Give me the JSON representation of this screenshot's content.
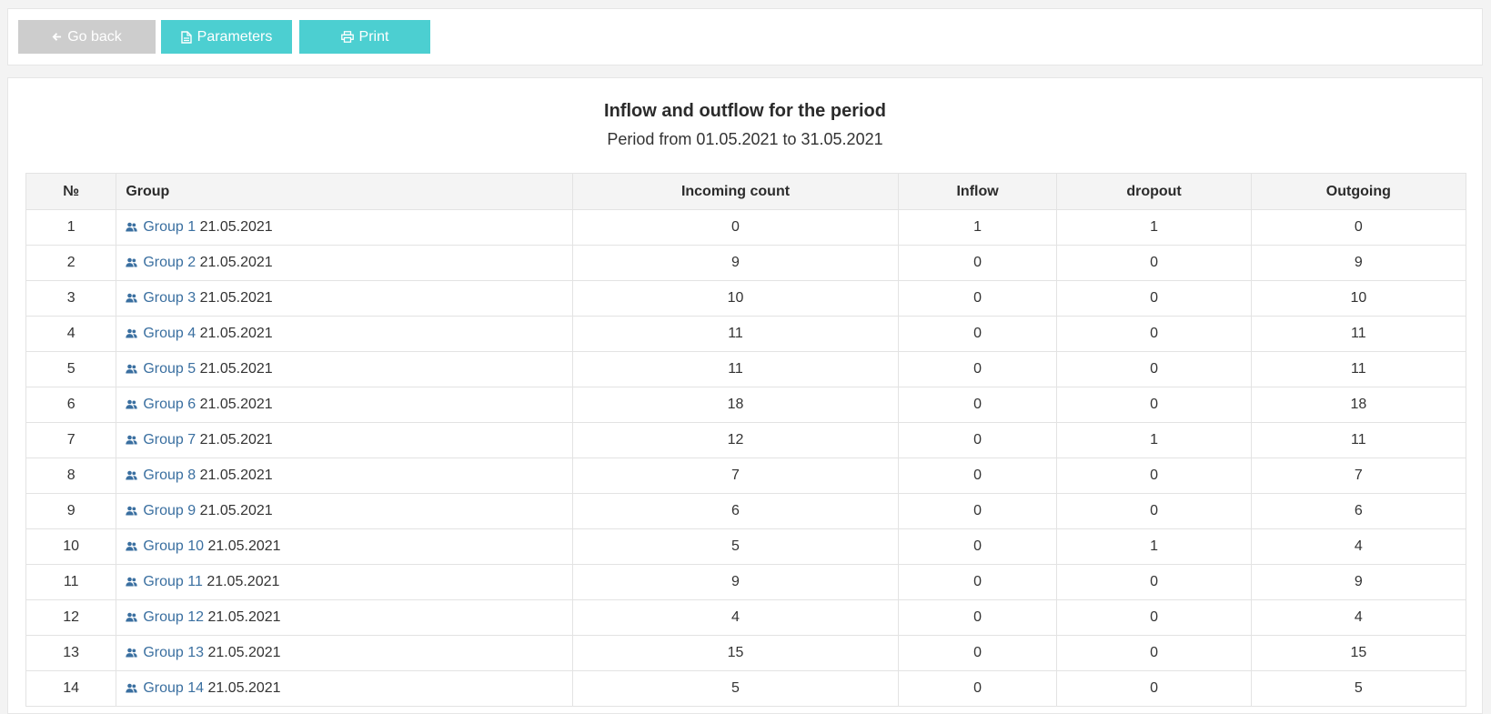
{
  "toolbar": {
    "back_label": "Go back",
    "parameters_label": "Parameters",
    "print_label": "Print"
  },
  "report": {
    "title": "Inflow and outflow for the period",
    "subtitle": "Period from 01.05.2021 to 31.05.2021"
  },
  "table": {
    "headers": {
      "num": "№",
      "group": "Group",
      "incoming": "Incoming count",
      "inflow": "Inflow",
      "dropout": "dropout",
      "outgoing": "Outgoing"
    },
    "rows": [
      {
        "num": "1",
        "group": "Group 1",
        "date": "21.05.2021",
        "incoming": "0",
        "inflow": "1",
        "dropout": "1",
        "outgoing": "0"
      },
      {
        "num": "2",
        "group": "Group 2",
        "date": "21.05.2021",
        "incoming": "9",
        "inflow": "0",
        "dropout": "0",
        "outgoing": "9"
      },
      {
        "num": "3",
        "group": "Group 3",
        "date": "21.05.2021",
        "incoming": "10",
        "inflow": "0",
        "dropout": "0",
        "outgoing": "10"
      },
      {
        "num": "4",
        "group": "Group 4",
        "date": "21.05.2021",
        "incoming": "11",
        "inflow": "0",
        "dropout": "0",
        "outgoing": "11"
      },
      {
        "num": "5",
        "group": "Group 5",
        "date": "21.05.2021",
        "incoming": "11",
        "inflow": "0",
        "dropout": "0",
        "outgoing": "11"
      },
      {
        "num": "6",
        "group": "Group 6",
        "date": "21.05.2021",
        "incoming": "18",
        "inflow": "0",
        "dropout": "0",
        "outgoing": "18"
      },
      {
        "num": "7",
        "group": "Group 7",
        "date": "21.05.2021",
        "incoming": "12",
        "inflow": "0",
        "dropout": "1",
        "outgoing": "11"
      },
      {
        "num": "8",
        "group": "Group 8",
        "date": "21.05.2021",
        "incoming": "7",
        "inflow": "0",
        "dropout": "0",
        "outgoing": "7"
      },
      {
        "num": "9",
        "group": "Group 9",
        "date": "21.05.2021",
        "incoming": "6",
        "inflow": "0",
        "dropout": "0",
        "outgoing": "6"
      },
      {
        "num": "10",
        "group": "Group 10",
        "date": "21.05.2021",
        "incoming": "5",
        "inflow": "0",
        "dropout": "1",
        "outgoing": "4"
      },
      {
        "num": "11",
        "group": "Group 11",
        "date": "21.05.2021",
        "incoming": "9",
        "inflow": "0",
        "dropout": "0",
        "outgoing": "9"
      },
      {
        "num": "12",
        "group": "Group 12",
        "date": "21.05.2021",
        "incoming": "4",
        "inflow": "0",
        "dropout": "0",
        "outgoing": "4"
      },
      {
        "num": "13",
        "group": "Group 13",
        "date": "21.05.2021",
        "incoming": "15",
        "inflow": "0",
        "dropout": "0",
        "outgoing": "15"
      },
      {
        "num": "14",
        "group": "Group 14",
        "date": "21.05.2021",
        "incoming": "5",
        "inflow": "0",
        "dropout": "0",
        "outgoing": "5"
      }
    ]
  },
  "colors": {
    "accent": "#4ccfd1",
    "back_button": "#cdcdcd",
    "link": "#3a6fa0"
  },
  "icons": {
    "back": "arrow-left-icon",
    "parameters": "document-icon",
    "print": "printer-icon",
    "group": "users-icon"
  }
}
